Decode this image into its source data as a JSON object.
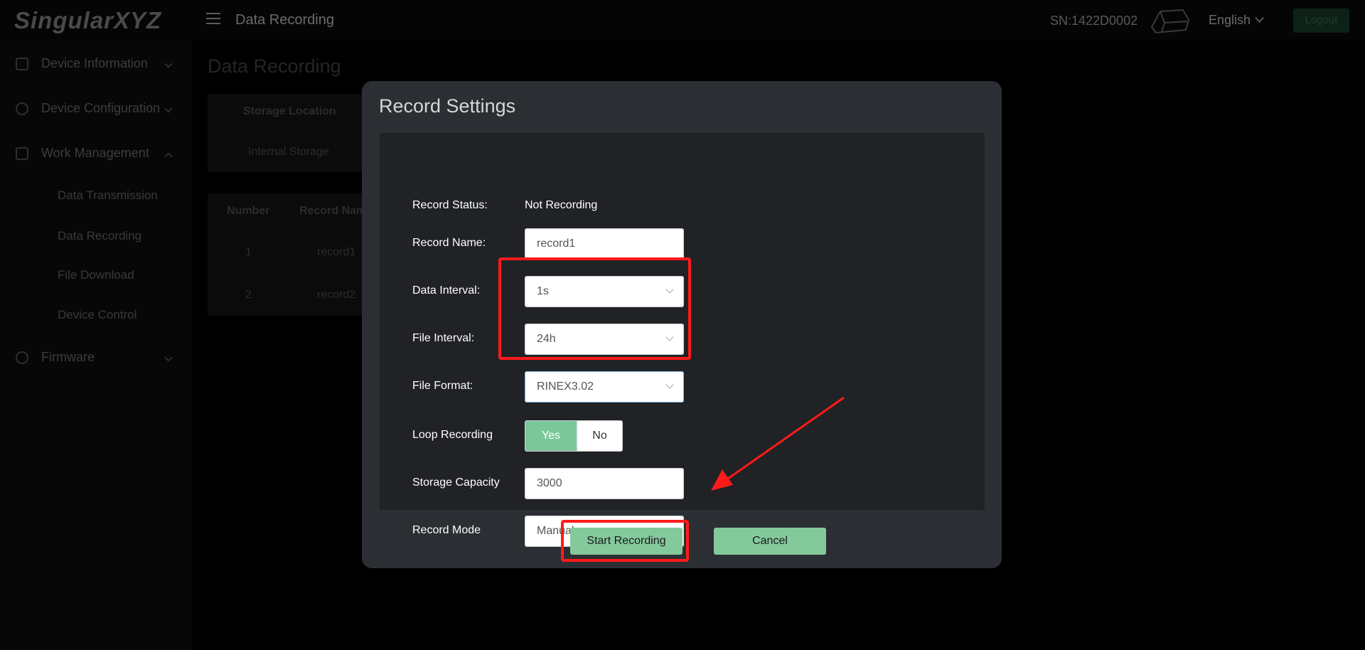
{
  "header": {
    "logo": "SingularXYZ",
    "title": "Data Recording",
    "serial": "SN:1422D0002",
    "language": "English",
    "logout": "Logout"
  },
  "sidebar": {
    "items": [
      {
        "label": "Device Information"
      },
      {
        "label": "Device Configuration"
      },
      {
        "label": "Work Management"
      },
      {
        "label": "Firmware"
      }
    ],
    "subitems": [
      {
        "label": "Data Transmission"
      },
      {
        "label": "Data Recording"
      },
      {
        "label": "File Download"
      },
      {
        "label": "Device Control"
      }
    ]
  },
  "content": {
    "title": "Data Recording",
    "storage_header": "Storage Location",
    "storage_value": "Internal Storage",
    "table": {
      "columns": [
        "Number",
        "Record Nam"
      ],
      "rows": [
        [
          "1",
          "record1"
        ],
        [
          "2",
          "record2"
        ]
      ]
    }
  },
  "modal": {
    "title": "Record Settings",
    "labels": {
      "status": "Record Status:",
      "name": "Record Name:",
      "data_interval": "Data Interval:",
      "file_interval": "File Interval:",
      "file_format": "File Format:",
      "loop": "Loop Recording",
      "capacity": "Storage Capacity",
      "mode": "Record Mode"
    },
    "values": {
      "status": "Not Recording",
      "name": "record1",
      "data_interval": "1s",
      "file_interval": "24h",
      "file_format": "RINEX3.02",
      "loop_yes": "Yes",
      "loop_no": "No",
      "capacity": "3000",
      "mode": "Manual"
    },
    "buttons": {
      "start": "Start Recording",
      "cancel": "Cancel"
    }
  },
  "colors": {
    "accent": "#84c99b",
    "annotation": "#ff1a1a"
  }
}
